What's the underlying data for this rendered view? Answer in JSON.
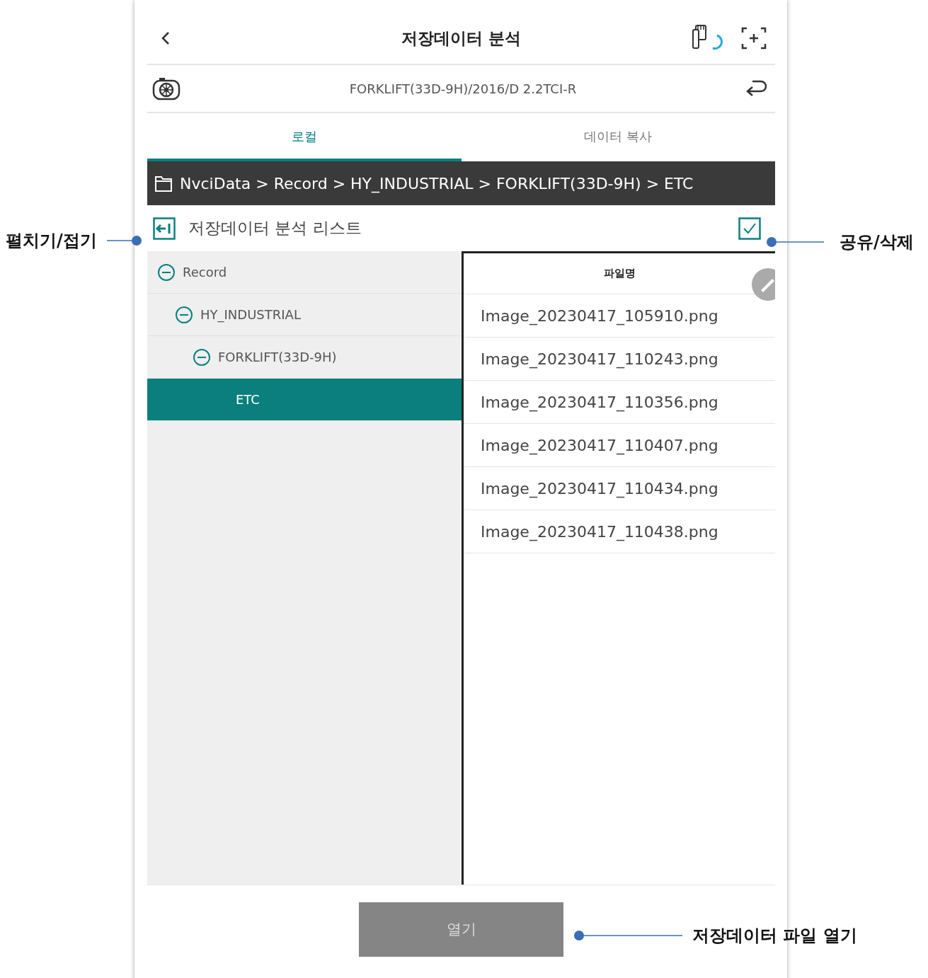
{
  "header": {
    "title": "저장데이터 분석"
  },
  "vehicle": {
    "name": "FORKLIFT(33D-9H)/2016/D 2.2TCI-R"
  },
  "tabs": [
    {
      "label": "로컬",
      "selected": true
    },
    {
      "label": "데이터 복사",
      "selected": false
    }
  ],
  "breadcrumb": {
    "path": "NvciData > Record > HY_INDUSTRIAL > FORKLIFT(33D-9H) > ETC"
  },
  "list_header": {
    "title": "저장데이터 분석 리스트"
  },
  "tree": [
    {
      "label": "Record",
      "expanded": true,
      "selected": false,
      "children": [
        {
          "label": "HY_INDUSTRIAL",
          "expanded": true,
          "selected": false,
          "children": [
            {
              "label": "FORKLIFT(33D-9H)",
              "expanded": true,
              "selected": false,
              "children": [
                {
                  "label": "ETC",
                  "selected": true
                }
              ]
            }
          ]
        }
      ]
    }
  ],
  "files": {
    "columns": [
      "파일명"
    ],
    "rows": [
      "Image_20230417_105910.png",
      "Image_20230417_110243.png",
      "Image_20230417_110356.png",
      "Image_20230417_110407.png",
      "Image_20230417_110434.png",
      "Image_20230417_110438.png"
    ]
  },
  "open_button": {
    "label": "열기",
    "disabled": true
  },
  "annotations": [
    {
      "kind": "left",
      "text": "펼치기/접기"
    },
    {
      "kind": "right",
      "text": "공유/삭제"
    },
    {
      "kind": "bottom",
      "text": "저장데이터 파일 열기"
    }
  ]
}
